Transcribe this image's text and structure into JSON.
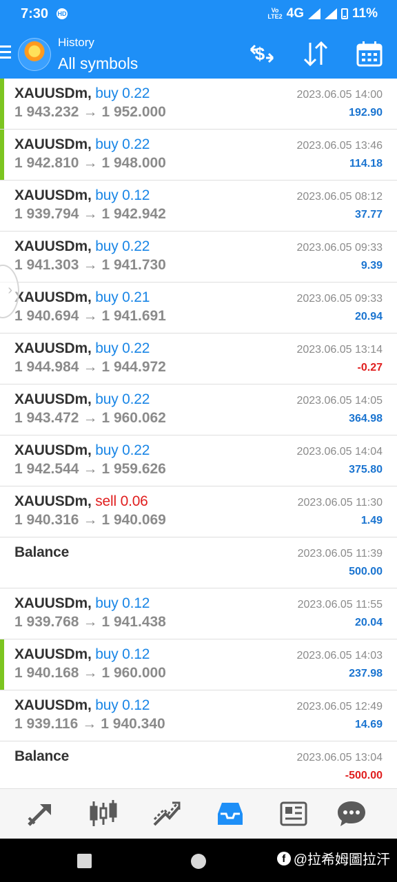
{
  "status_bar": {
    "time": "7:30",
    "hd_badge": "HD",
    "volte": "Vo LTE2",
    "network": "4G",
    "battery": "11%"
  },
  "header": {
    "subtitle": "History",
    "title": "All symbols"
  },
  "trades": [
    {
      "symbol": "XAUUSDm,",
      "side": "buy",
      "volume": "0.22",
      "open": "1 943.232",
      "close": "1 952.000",
      "date": "2023.06.05 14:00",
      "profit": "192.90",
      "profit_sign": "pos",
      "marker": true
    },
    {
      "symbol": "XAUUSDm,",
      "side": "buy",
      "volume": "0.22",
      "open": "1 942.810",
      "close": "1 948.000",
      "date": "2023.06.05 13:46",
      "profit": "114.18",
      "profit_sign": "pos",
      "marker": true
    },
    {
      "symbol": "XAUUSDm,",
      "side": "buy",
      "volume": "0.12",
      "open": "1 939.794",
      "close": "1 942.942",
      "date": "2023.06.05 08:12",
      "profit": "37.77",
      "profit_sign": "pos",
      "marker": false
    },
    {
      "symbol": "XAUUSDm,",
      "side": "buy",
      "volume": "0.22",
      "open": "1 941.303",
      "close": "1 941.730",
      "date": "2023.06.05 09:33",
      "profit": "9.39",
      "profit_sign": "pos",
      "marker": false
    },
    {
      "symbol": "XAUUSDm,",
      "side": "buy",
      "volume": "0.21",
      "open": "1 940.694",
      "close": "1 941.691",
      "date": "2023.06.05 09:33",
      "profit": "20.94",
      "profit_sign": "pos",
      "marker": false
    },
    {
      "symbol": "XAUUSDm,",
      "side": "buy",
      "volume": "0.22",
      "open": "1 944.984",
      "close": "1 944.972",
      "date": "2023.06.05 13:14",
      "profit": "-0.27",
      "profit_sign": "neg",
      "marker": false
    },
    {
      "symbol": "XAUUSDm,",
      "side": "buy",
      "volume": "0.22",
      "open": "1 943.472",
      "close": "1 960.062",
      "date": "2023.06.05 14:05",
      "profit": "364.98",
      "profit_sign": "pos",
      "marker": false
    },
    {
      "symbol": "XAUUSDm,",
      "side": "buy",
      "volume": "0.22",
      "open": "1 942.544",
      "close": "1 959.626",
      "date": "2023.06.05 14:04",
      "profit": "375.80",
      "profit_sign": "pos",
      "marker": false
    },
    {
      "symbol": "XAUUSDm,",
      "side": "sell",
      "volume": "0.06",
      "open": "1 940.316",
      "close": "1 940.069",
      "date": "2023.06.05 11:30",
      "profit": "1.49",
      "profit_sign": "pos",
      "marker": false
    },
    {
      "symbol": "Balance",
      "side": "",
      "volume": "",
      "open": "",
      "close": "",
      "date": "2023.06.05 11:39",
      "profit": "500.00",
      "profit_sign": "pos",
      "marker": false
    },
    {
      "symbol": "XAUUSDm,",
      "side": "buy",
      "volume": "0.12",
      "open": "1 939.768",
      "close": "1 941.438",
      "date": "2023.06.05 11:55",
      "profit": "20.04",
      "profit_sign": "pos",
      "marker": false
    },
    {
      "symbol": "XAUUSDm,",
      "side": "buy",
      "volume": "0.12",
      "open": "1 940.168",
      "close": "1 960.000",
      "date": "2023.06.05 14:03",
      "profit": "237.98",
      "profit_sign": "pos",
      "marker": true
    },
    {
      "symbol": "XAUUSDm,",
      "side": "buy",
      "volume": "0.12",
      "open": "1 939.116",
      "close": "1 940.340",
      "date": "2023.06.05 12:49",
      "profit": "14.69",
      "profit_sign": "pos",
      "marker": false
    },
    {
      "symbol": "Balance",
      "side": "",
      "volume": "",
      "open": "",
      "close": "",
      "date": "2023.06.05 13:04",
      "profit": "-500.00",
      "profit_sign": "neg",
      "marker": false
    }
  ],
  "arrow": "→",
  "bottom_nav": [
    {
      "name": "trade-icon",
      "active": false
    },
    {
      "name": "candlestick-chart-icon",
      "active": false
    },
    {
      "name": "chart-trend-icon",
      "active": false
    },
    {
      "name": "history-inbox-icon",
      "active": true
    },
    {
      "name": "news-icon",
      "active": false
    },
    {
      "name": "chat-icon",
      "active": false
    }
  ],
  "watermark": "@拉希姆圖拉汗",
  "colors": {
    "header_bg": "#1e8ff7",
    "buy": "#1a86e6",
    "sell": "#e01e1e",
    "profit_pos": "#1a74d0",
    "profit_neg": "#e01e1e",
    "marker": "#7cc520",
    "nav_active": "#1e8ff7",
    "nav_inactive": "#5a5a5a"
  }
}
